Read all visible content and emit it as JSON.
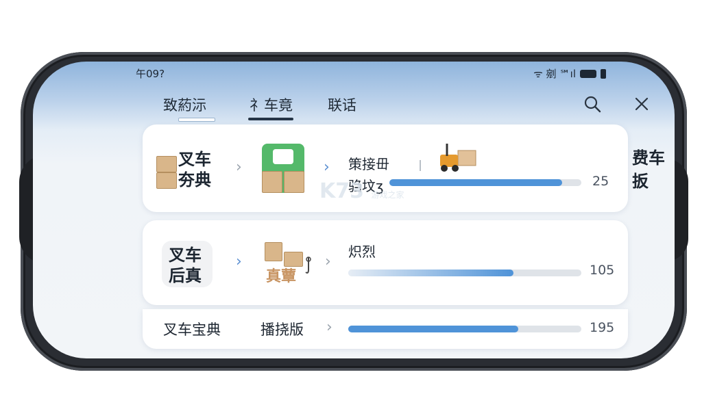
{
  "status": {
    "time": "午09?",
    "icons_text": "ᯤ 剜 ℠ıl"
  },
  "tabs": [
    {
      "label": "致葯沶"
    },
    {
      "label": "礻车竟"
    },
    {
      "label": "联话"
    }
  ],
  "cards": [
    {
      "title_l1": "叉车",
      "title_l2": "夯典",
      "label_top": "策接毌",
      "label_bottom": "驺坟ʒ",
      "value": "25",
      "progress": 0.9
    },
    {
      "title_l1": "叉车",
      "title_l2": "后真",
      "mid_text": "真蕈",
      "label_top": "炽烈",
      "value": "105",
      "progress": 0.71
    },
    {
      "title": "叉车宝典",
      "mid_text": "播挠版",
      "value": "195",
      "progress": 0.73
    }
  ],
  "side_text": {
    "l1": "费车",
    "l2": "扳"
  },
  "watermark": {
    "text": "K73",
    "sub": "游戏之家"
  },
  "colors": {
    "accent": "#4f93d8",
    "app_green": "#54b96a",
    "forklift": "#e59a2e"
  },
  "icons": [
    "search-icon",
    "close-icon",
    "chevron-right-icon",
    "forklift-icon",
    "app-icon",
    "box-icon"
  ]
}
